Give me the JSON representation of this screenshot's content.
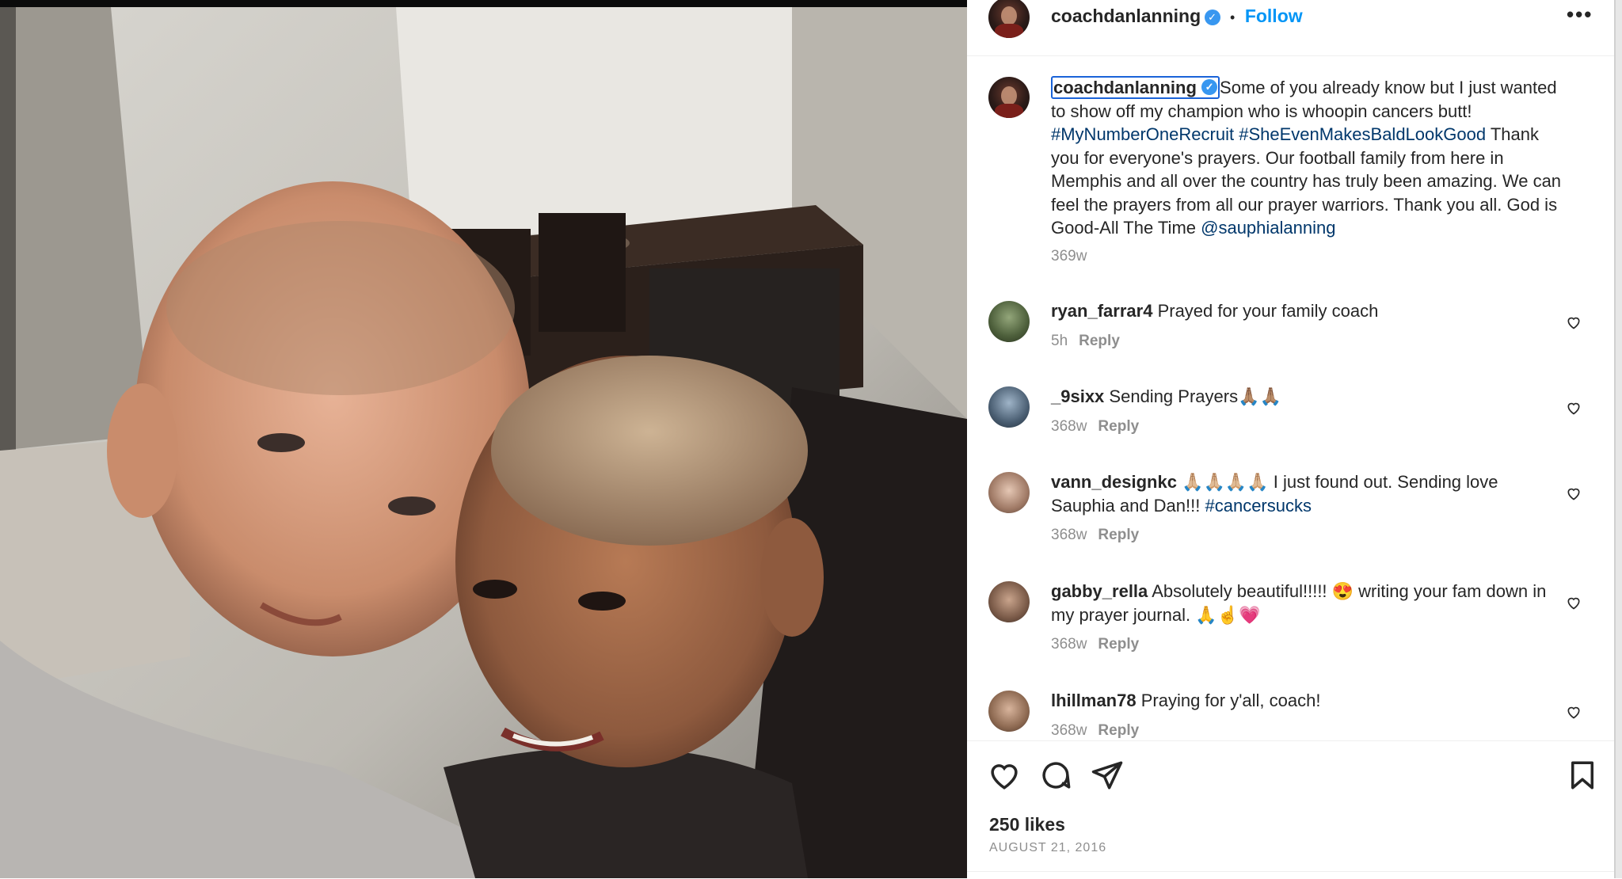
{
  "post": {
    "username": "coachdanlanning",
    "verified_icon": "verified-badge-icon",
    "separator": "•",
    "follow_label": "Follow",
    "more_label": "•••"
  },
  "caption": {
    "username": "coachdanlanning",
    "text1": "Some of you already know but I just wanted to show off my champion who is whoopin cancers butt! ",
    "tag1": "#MyNumberOneRecruit",
    "tag2": "#SheEvenMakesBaldLookGood",
    "text2": "Thank you for everyone's prayers. Our football family from here in Memphis and all over the country has truly been amazing. We can feel the prayers from all our prayer warriors. Thank you all. God is Good-All The Time ",
    "mention": "@sauphialanning",
    "time": "369w"
  },
  "comments": [
    {
      "username": "ryan_farrar4",
      "text": "Prayed for your family coach",
      "tag": "",
      "time": "5h",
      "reply": "Reply"
    },
    {
      "username": "_9sixx",
      "text": "Sending Prayers🙏🏽🙏🏽",
      "tag": "",
      "time": "368w",
      "reply": "Reply"
    },
    {
      "username": "vann_designkc",
      "text": "🙏🏼🙏🏼🙏🏼🙏🏼 I just found out. Sending love Sauphia and Dan!!! ",
      "tag": "#cancersucks",
      "time": "368w",
      "reply": "Reply"
    },
    {
      "username": "gabby_rella",
      "text": "Absolutely beautiful!!!!! 😍 writing your fam down in my prayer journal. 🙏☝️💗",
      "tag": "",
      "time": "368w",
      "reply": "Reply"
    },
    {
      "username": "lhillman78",
      "text": "Praying for y'all, coach!",
      "tag": "",
      "time": "368w",
      "reply": "Reply"
    }
  ],
  "footer": {
    "likes": "250 likes",
    "date": "AUGUST 21, 2016"
  },
  "colors": {
    "link_blue": "#0095f6",
    "hashtag": "#00376b",
    "muted": "#8e8e8e",
    "text": "#262626",
    "focus_ring": "#1a63d8"
  }
}
